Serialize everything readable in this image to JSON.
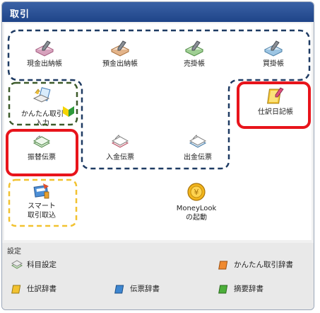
{
  "header": {
    "title": "取引"
  },
  "tiles": {
    "cash_book": "現金出納帳",
    "deposit_book": "預金出納帳",
    "sales_ledger": "売掛帳",
    "purchase_ledger": "買掛帳",
    "easy_entry_line1": "かんたん取引",
    "easy_entry_line2": "入力",
    "journal": "仕訳日記帳",
    "transfer_slip": "振替伝票",
    "receipt_slip": "入金伝票",
    "payment_slip": "出金伝票",
    "smart_import_line1": "スマート",
    "smart_import_line2": "取引取込",
    "moneylook_line1": "MoneyLook",
    "moneylook_line2": "の起動"
  },
  "settings": {
    "title": "設定",
    "account_settings": "科目設定",
    "easy_dictionary": "かんたん取引辞書",
    "journal_dictionary": "仕訳辞書",
    "slip_dictionary": "伝票辞書",
    "summary_dictionary": "摘要辞書"
  },
  "colors": {
    "header": "#2b519a",
    "dashed_navy": "#1f3b63",
    "dashed_green": "#3c5a2a",
    "dashed_yellow": "#f2c230",
    "highlight_red": "#e8141b"
  }
}
